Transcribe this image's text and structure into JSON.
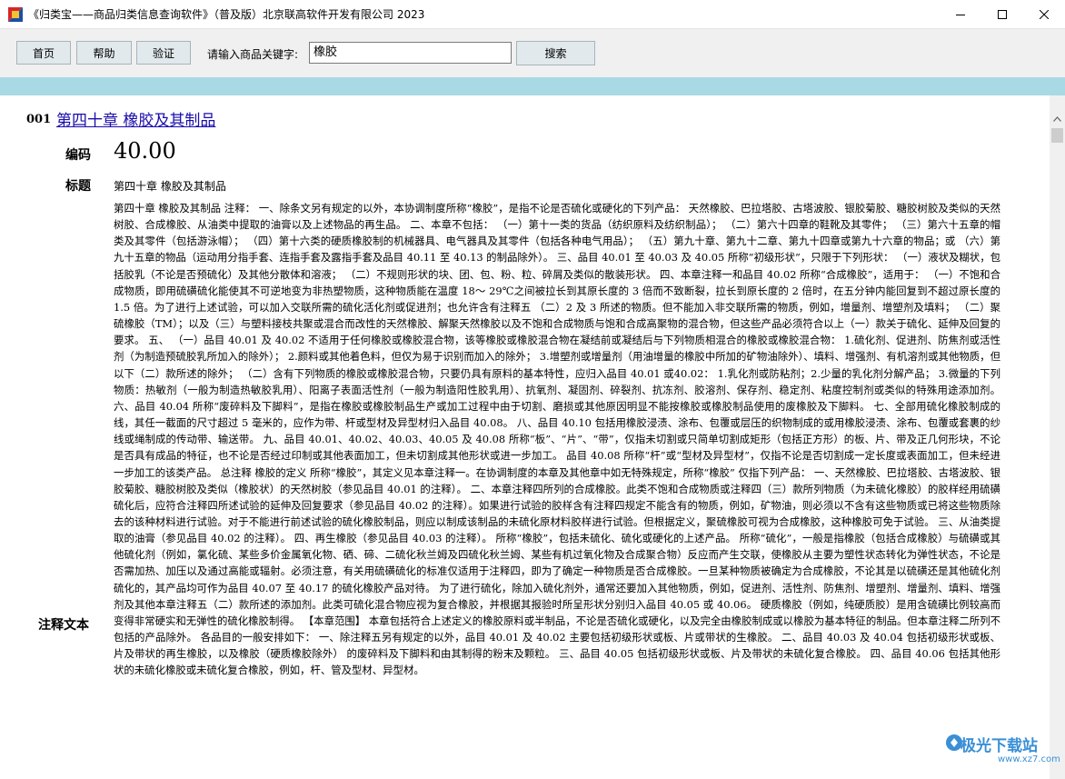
{
  "window": {
    "title": "《归类宝——商品归类信息查询软件》（普及版）北京联高软件开发有限公司 2023"
  },
  "toolbar": {
    "home_label": "首页",
    "help_label": "帮助",
    "verify_label": "验证",
    "keyword_label": "请输入商品关键字:",
    "search_value": "橡胶",
    "search_label": "搜索"
  },
  "record": {
    "number": "001",
    "link_text": "第四十章 橡胶及其制品",
    "code_label": "编码",
    "code_value": "40.00",
    "title_label": "标题",
    "title_value": "第四十章 橡胶及其制品",
    "notes_label": "注释文本",
    "notes_text": "第四十章 橡胶及其制品 注释： 一、除条文另有规定的以外，本协调制度所称“橡胶”，是指不论是否硫化或硬化的下列产品： 天然橡胶、巴拉塔胶、古塔波胶、银胶菊胶、糖胶树胶及类似的天然树胶、合成橡胶、从油类中提取的油膏以及上述物品的再生品。 二、本章不包括： （一）第十一类的货品（纺织原料及纺织制品）； （二）第六十四章的鞋靴及其零件； （三）第六十五章的帽类及其零件（包括游泳帽）； （四）第十六类的硬质橡胶制的机械器具、电气器具及其零件（包括各种电气用品）； （五）第九十章、第九十二章、第九十四章或第九十六章的物品；或 （六）第九十五章的物品（运动用分指手套、连指手套及露指手套及品目 40.11 至 40.13 的制品除外）。 三、品目 40.01 至 40.03 及 40.05 所称“初级形状”，只限于下列形状： （一）液状及糊状，包括胶乳（不论是否预硫化）及其他分散体和溶液； （二）不规则形状的块、团、包、粉、粒、碎屑及类似的散装形状。 四、本章注释一和品目 40.02 所称“合成橡胶”，适用于： （一）不饱和合成物质，即用硫磺硫化能使其不可逆地变为非热塑物质，这种物质能在温度 18～ 29℃之间被拉长到其原长度的 3 倍而不致断裂，拉长到原长度的 2 倍时，在五分钟内能回复到不超过原长度的 1.5 倍。为了进行上述试验，可以加入交联所需的硫化活化剂或促进剂；也允许含有注释五 （二）2 及 3 所述的物质。但不能加入非交联所需的物质，例如，增量剂、增塑剂及填料； （二）聚硫橡胶（TM）；以及（三）与塑料接枝共聚或混合而改性的天然橡胶、解聚天然橡胶以及不饱和合成物质与饱和合成高聚物的混合物，但这些产品必须符合以上（一）款关于硫化、延伸及回复的要求。 五、 （一）品目 40.01 及 40.02 不适用于任何橡胶或橡胶混合物，该等橡胶或橡胶混合物在凝结前或凝结后与下列物质相混合的橡胶或橡胶混合物： 1.硫化剂、促进剂、防焦剂或活性剂（为制造预硫胶乳所加入的除外）； 2.颜料或其他着色料，但仅为易于识别而加入的除外； 3.增塑剂或增量剂（用油增量的橡胶中所加的矿物油除外）、填料、增强剂、有机溶剂或其他物质，但以下（二）款所述的除外； （二）含有下列物质的橡胶或橡胶混合物，只要仍具有原料的基本特性，应归入品目 40.01 或40.02： 1.乳化剂或防粘剂；2.少量的乳化剂分解产品； 3.微量的下列物质：热敏剂（一般为制造热敏胶乳用）、阳离子表面活性剂（一般为制造阳性胶乳用）、抗氧剂、凝固剂、碎裂剂、抗冻剂、胶溶剂、保存剂、稳定剂、粘度控制剂或类似的特殊用途添加剂。 六、品目 40.04 所称“废碎料及下脚料”，是指在橡胶或橡胶制品生产或加工过程中由于切割、磨损或其他原因明显不能按橡胶或橡胶制品使用的废橡胶及下脚料。 七、全部用硫化橡胶制成的线，其任一截面的尺寸超过 5 毫米的，应作为带、杆或型材及异型材归入品目 40.08。 八、品目 40.10 包括用橡胶浸渍、涂布、包覆或层压的织物制成的或用橡胶浸渍、涂布、包覆或套裹的纱线或绳制成的传动带、输送带。 九、品目 40.01、40.02、40.03、40.05 及 40.08 所称“板”、“片”、“带”，仅指未切割或只简单切割成矩形（包括正方形）的板、片、带及正几何形块，不论是否具有成品的特征，也不论是否经过印制或其他表面加工，但未切割成其他形状或进一步加工。 品目 40.08 所称“杆”或“型材及异型材”，仅指不论是否切割成一定长度或表面加工，但未经进一步加工的该类产品。 总注释 橡胶的定义 所称“橡胶”，其定义见本章注释一。在协调制度的本章及其他章中如无特殊规定，所称“橡胶” 仅指下列产品： 一、天然橡胶、巴拉塔胶、古塔波胶、银胶菊胶、糖胶树胶及类似（橡胶状）的天然树胶（参见品目 40.01 的注释）。 二、本章注释四所列的合成橡胶。此类不饱和合成物质或注释四（三）款所列物质（为未硫化橡胶）的胶样经用硫磺硫化后，应符合注释四所述试验的延伸及回复要求（参见品目 40.02 的注释）。如果进行试验的胶样含有注释四规定不能含有的物质，例如，矿物油，则必须以不含有这些物质或已将这些物质除去的该种材料进行试验。对于不能进行前述试验的硫化橡胶制品，则应以制成该制品的未硫化原材料胶样进行试验。但根据定义，聚硫橡胶可视为合成橡胶，这种橡胶可免于试验。 三、从油类提取的油膏（参见品目 40.02 的注释）。 四、再生橡胶（参见品目 40.03 的注释）。 所称“橡胶”，包括未硫化、硫化或硬化的上述产品。 所称“硫化”，一般是指橡胶（包括合成橡胶）与硫磺或其他硫化剂（例如，氯化硫、某些多价金属氧化物、硒、碲、二硫化秋兰姆及四硫化秋兰姆、某些有机过氧化物及合成聚合物）反应而产生交联，使橡胶从主要为塑性状态转化为弹性状态，不论是否需加热、加压以及通过高能或辐射。必须注意，有关用硫磺硫化的标准仅适用于注释四，即为了确定一种物质是否合成橡胶。一旦某种物质被确定为合成橡胶，不论其是以硫磺还是其他硫化剂硫化的，其产品均可作为品目 40.07 至 40.17 的硫化橡胶产品对待。 为了进行硫化，除加入硫化剂外，通常还要加入其他物质，例如，促进剂、活性剂、防焦剂、增塑剂、增量剂、填料、增强剂及其他本章注释五（二）款所述的添加剂。此类可硫化混合物应视为复合橡胶，并根据其报验时所呈形状分别归入品目 40.05 或 40.06。 硬质橡胶（例如，纯硬质胶）是用含硫磺比例较高而变得非常硬实和无弹性的硫化橡胶制得。 【本章范围】 本章包括符合上述定义的橡胶原料或半制品，不论是否硫化或硬化，以及完全由橡胶制成或以橡胶为基本特征的制品。但本章注释二所列不包括的产品除外。 各品目的一般安排如下： 一、除注释五另有规定的以外，品目 40.01 及 40.02 主要包括初级形状或板、片或带状的生橡胶。 二、品目 40.03 及 40.04 包括初级形状或板、片及带状的再生橡胶，以及橡胶（硬质橡胶除外） 的废碎料及下脚料和由其制得的粉末及颗粒。 三、品目 40.05 包括初级形状或板、片及带状的未硫化复合橡胶。 四、品目 40.06 包括其他形状的未硫化橡胶或未硫化复合橡胶，例如，杆、管及型材、异型材。"
  },
  "watermark": {
    "text": "极光下载站",
    "sub": "www.xz7.com"
  }
}
